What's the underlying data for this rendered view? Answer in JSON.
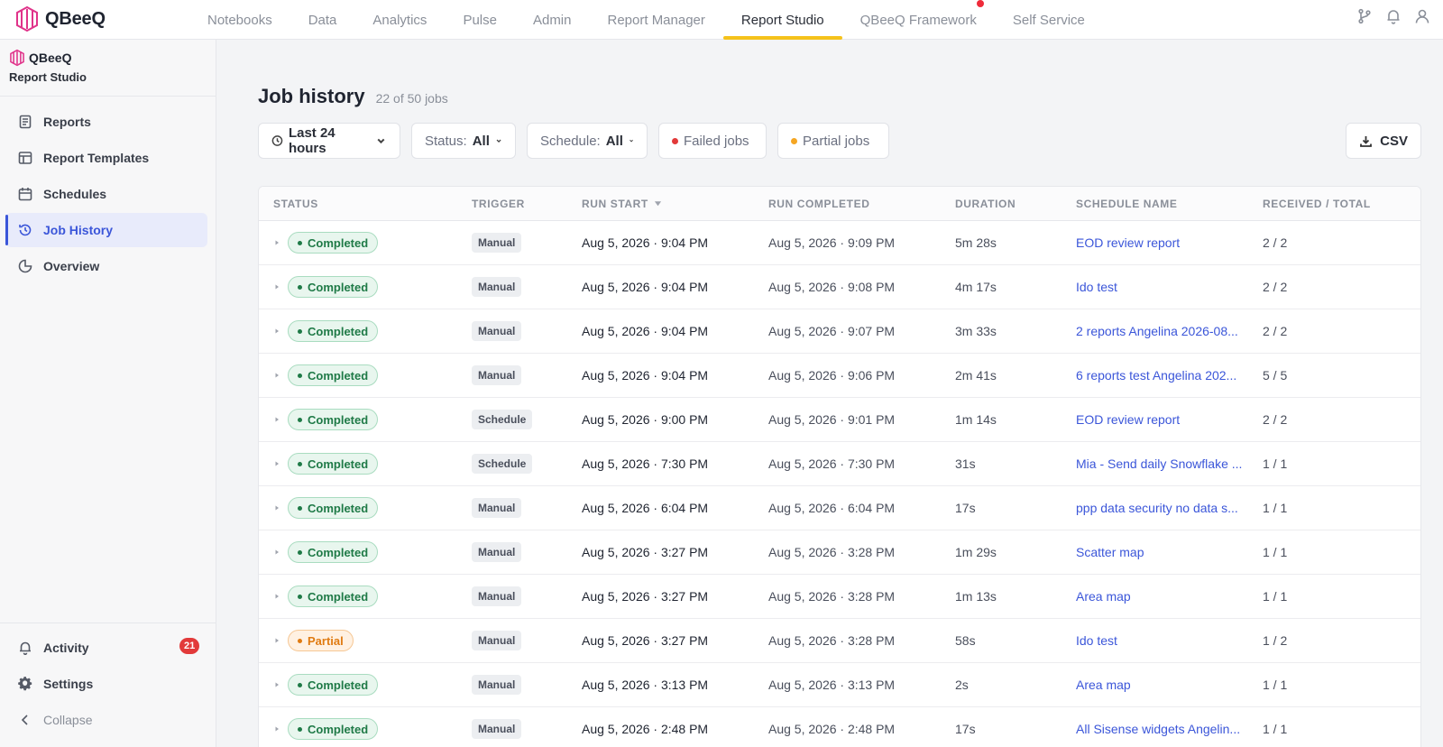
{
  "brand": {
    "name": "QBeeQ"
  },
  "topnav": {
    "tabs": [
      {
        "label": "Notebooks"
      },
      {
        "label": "Data"
      },
      {
        "label": "Analytics"
      },
      {
        "label": "Pulse"
      },
      {
        "label": "Admin"
      },
      {
        "label": "Report Manager"
      },
      {
        "label": "Report Studio",
        "active": true
      },
      {
        "label": "QBeeQ Framework",
        "notification_dot": true
      },
      {
        "label": "Self Service"
      }
    ],
    "icons": [
      "branch-icon",
      "bell-icon",
      "user-icon"
    ]
  },
  "sidebar": {
    "brand": "QBeeQ",
    "subtitle": "Report Studio",
    "items": [
      {
        "label": "Reports",
        "icon": "document-icon"
      },
      {
        "label": "Report Templates",
        "icon": "template-icon"
      },
      {
        "label": "Schedules",
        "icon": "calendar-icon"
      },
      {
        "label": "Job History",
        "icon": "history-icon",
        "active": true
      },
      {
        "label": "Overview",
        "icon": "pie-icon"
      }
    ],
    "bottom": {
      "activity": {
        "label": "Activity",
        "badge": "21"
      },
      "settings": {
        "label": "Settings"
      },
      "collapse": {
        "label": "Collapse"
      }
    }
  },
  "page": {
    "title": "Job history",
    "count": "22 of 50 jobs",
    "filters": {
      "time": "Last 24 hours",
      "status_label": "Status:",
      "status_value": "All",
      "schedule_label": "Schedule:",
      "schedule_value": "All",
      "failed": "Failed jobs",
      "partial": "Partial jobs"
    },
    "csv": "CSV",
    "colors": {
      "failed": "#e23a3a",
      "partial": "#f5a623",
      "accent": "#3b56d9",
      "active_tab_underline": "#f5c21b"
    }
  },
  "table": {
    "headers": {
      "status": "STATUS",
      "trigger": "TRIGGER",
      "start": "RUN START",
      "completed": "RUN COMPLETED",
      "duration": "DURATION",
      "schedule": "SCHEDULE NAME",
      "received": "RECEIVED / TOTAL"
    },
    "rows": [
      {
        "status": "Completed",
        "trigger": "Manual",
        "start": "Aug 5, 2026 · 9:04 PM",
        "completed": "Aug 5, 2026 · 9:09 PM",
        "duration": "5m 28s",
        "schedule": "EOD review report",
        "received": "2 / 2"
      },
      {
        "status": "Completed",
        "trigger": "Manual",
        "start": "Aug 5, 2026 · 9:04 PM",
        "completed": "Aug 5, 2026 · 9:08 PM",
        "duration": "4m 17s",
        "schedule": "Ido test",
        "received": "2 / 2"
      },
      {
        "status": "Completed",
        "trigger": "Manual",
        "start": "Aug 5, 2026 · 9:04 PM",
        "completed": "Aug 5, 2026 · 9:07 PM",
        "duration": "3m 33s",
        "schedule": "2 reports Angelina 2026-08...",
        "received": "2 / 2"
      },
      {
        "status": "Completed",
        "trigger": "Manual",
        "start": "Aug 5, 2026 · 9:04 PM",
        "completed": "Aug 5, 2026 · 9:06 PM",
        "duration": "2m 41s",
        "schedule": "6 reports test Angelina 202...",
        "received": "5 / 5"
      },
      {
        "status": "Completed",
        "trigger": "Schedule",
        "start": "Aug 5, 2026 · 9:00 PM",
        "completed": "Aug 5, 2026 · 9:01 PM",
        "duration": "1m 14s",
        "schedule": "EOD review report",
        "received": "2 / 2"
      },
      {
        "status": "Completed",
        "trigger": "Schedule",
        "start": "Aug 5, 2026 · 7:30 PM",
        "completed": "Aug 5, 2026 · 7:30 PM",
        "duration": "31s",
        "schedule": "Mia - Send daily Snowflake ...",
        "received": "1 / 1"
      },
      {
        "status": "Completed",
        "trigger": "Manual",
        "start": "Aug 5, 2026 · 6:04 PM",
        "completed": "Aug 5, 2026 · 6:04 PM",
        "duration": "17s",
        "schedule": "ppp data security no data s...",
        "received": "1 / 1"
      },
      {
        "status": "Completed",
        "trigger": "Manual",
        "start": "Aug 5, 2026 · 3:27 PM",
        "completed": "Aug 5, 2026 · 3:28 PM",
        "duration": "1m 29s",
        "schedule": "Scatter map",
        "received": "1 / 1"
      },
      {
        "status": "Completed",
        "trigger": "Manual",
        "start": "Aug 5, 2026 · 3:27 PM",
        "completed": "Aug 5, 2026 · 3:28 PM",
        "duration": "1m 13s",
        "schedule": "Area map",
        "received": "1 / 1"
      },
      {
        "status": "Partial",
        "trigger": "Manual",
        "start": "Aug 5, 2026 · 3:27 PM",
        "completed": "Aug 5, 2026 · 3:28 PM",
        "duration": "58s",
        "schedule": "Ido test",
        "received": "1 / 2"
      },
      {
        "status": "Completed",
        "trigger": "Manual",
        "start": "Aug 5, 2026 · 3:13 PM",
        "completed": "Aug 5, 2026 · 3:13 PM",
        "duration": "2s",
        "schedule": "Area map",
        "received": "1 / 1"
      },
      {
        "status": "Completed",
        "trigger": "Manual",
        "start": "Aug 5, 2026 · 2:48 PM",
        "completed": "Aug 5, 2026 · 2:48 PM",
        "duration": "17s",
        "schedule": "All Sisense widgets Angelin...",
        "received": "1 / 1"
      }
    ]
  }
}
